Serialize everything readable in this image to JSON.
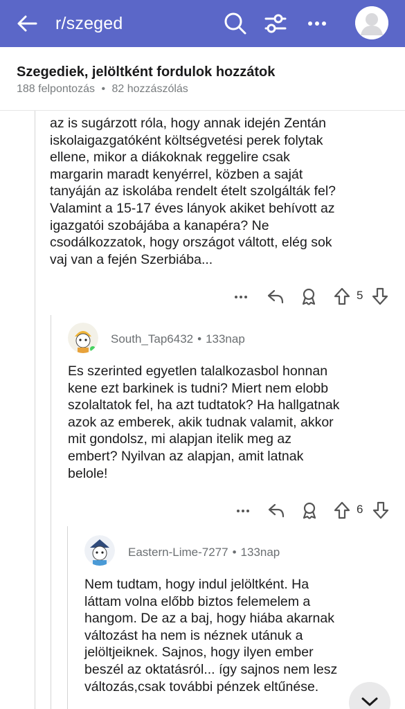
{
  "header": {
    "title": "r/szeged",
    "bg_color": "#5b67c8"
  },
  "post": {
    "title": "Szegediek, jelöltként fordulok hozzátok",
    "upvotes": "188 felpontozás",
    "separator": "•",
    "comments": "82 hozzászólás"
  },
  "comments": [
    {
      "text": "az is sugárzott róla, hogy annak idején Zentán\niskolaigazgatóként költségvetési perek folytak\nellene, mikor a diákoknak reggelire csak\nmargarin maradt kenyérrel, közben a saját\ntanyáján az iskolába rendelt ételt szolgálták fel?\nValamint a 15-17 éves lányok akiket behívott az\nigazgatói szobájába a kanapéra? Ne\ncsodálkozzatok, hogy országot váltott, elég sok\nvaj van a fején Szerbiába...",
      "votes": "5"
    },
    {
      "author": "South_Tap6432",
      "age": "133nap",
      "text": "Es szerinted egyetlen talalkozasbol honnan\nkene ezt barkinek is tudni? Miert nem elobb\nszolaltatok fel, ha azt tudtatok? Ha hallgatnak\nazok az emberek, akik tudnak valamit, akkor\nmit gondolsz, mi alapjan itelik meg az\nembert? Nyilvan az alapjan, amit latnak\nbelole!",
      "votes": "6"
    },
    {
      "author": "Eastern-Lime-7277",
      "age": "133nap",
      "text": "Nem tudtam, hogy indul jelöltként. Ha\nláttam volna előbb biztos felemelem a\nhangom. De az a baj, hogy hiába akarnak\nváltozást ha nem is néznek utánuk a\njelöltjeiknek. Sajnos, hogy ilyen ember\nbeszél az oktatásról... így sajnos nem lesz\nváltozás,csak további pénzek eltűnése."
    }
  ],
  "icons": {
    "back": "arrow-left-icon",
    "search": "search-icon",
    "filter": "sliders-icon",
    "more": "more-horizontal-icon",
    "avatar": "user-avatar",
    "reply": "reply-icon",
    "award": "award-icon",
    "upvote": "upvote-arrow-icon",
    "downvote": "downvote-arrow-icon",
    "scroll_down": "chevron-down-icon"
  }
}
